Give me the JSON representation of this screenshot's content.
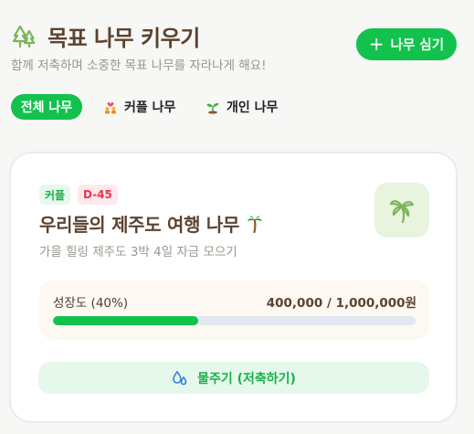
{
  "header": {
    "title": "목표 나무 키우기",
    "subtitle": "함께 저축하며 소중한 목표 나무를 자라나게 해요!",
    "plant_button_label": "나무 심기"
  },
  "tabs": [
    {
      "label": "전체 나무",
      "active": true
    },
    {
      "label": "커플 나무",
      "icon": "couple-icon",
      "active": false
    },
    {
      "label": "개인 나무",
      "icon": "sprout-icon",
      "active": false
    }
  ],
  "goal_card": {
    "type_badge": "커플",
    "dday_badge": "D-45",
    "title": "우리들의 제주도 여행 나무",
    "title_icon": "palm-tree-icon",
    "description": "가을 힐링 제주도 3박 4일 자금 모으기",
    "progress_label": "성장도 (40%)",
    "progress_fraction": 0.4,
    "amount_text": "400,000 / 1,000,000원",
    "water_button_label": "물주기 (저축하기)"
  },
  "colors": {
    "accent": "#12c24d",
    "title_brown": "#5b4330",
    "badge_red": "#e8344e",
    "tree_bg": "#e9f4df",
    "water_blue": "#2f7fdd"
  }
}
